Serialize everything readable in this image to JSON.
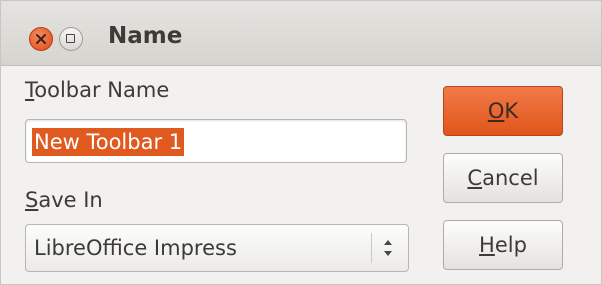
{
  "window": {
    "title": "Name"
  },
  "form": {
    "toolbar_name_label_mnemonic": "T",
    "toolbar_name_label_rest": "oolbar Name",
    "toolbar_name_value": "New Toolbar 1",
    "save_in_label_mnemonic": "S",
    "save_in_label_rest": "ave In",
    "save_in_value": "LibreOffice Impress"
  },
  "buttons": {
    "ok_mnemonic": "O",
    "ok_rest": "K",
    "cancel_mnemonic": "C",
    "cancel_rest": "ancel",
    "help_mnemonic": "H",
    "help_rest": "elp"
  },
  "icons": {
    "close": "close-icon",
    "restore": "restore-icon",
    "spinner": "up-down-arrows-icon"
  },
  "colors": {
    "accent": "#e0591f",
    "window_bg": "#f2f1f0",
    "text": "#3c3b37"
  }
}
